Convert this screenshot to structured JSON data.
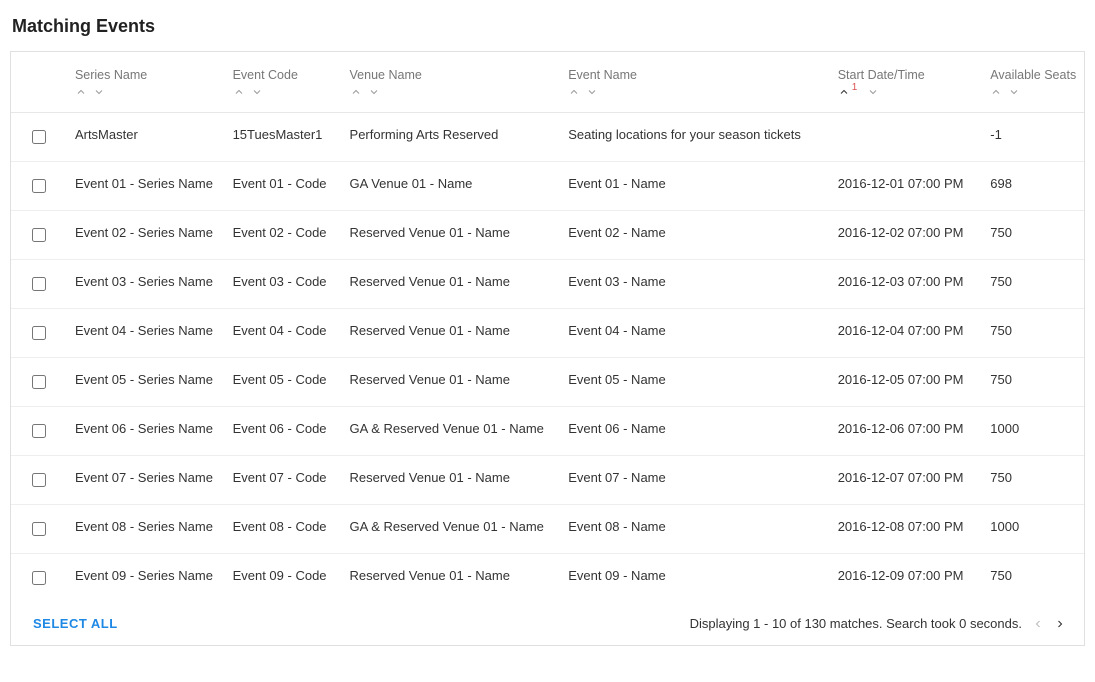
{
  "title": "Matching Events",
  "columns": {
    "series": "Series Name",
    "code": "Event Code",
    "venue": "Venue Name",
    "ename": "Event Name",
    "datetime": "Start Date/Time",
    "seats": "Available Seats"
  },
  "sort": {
    "active_column": "datetime",
    "direction": "asc",
    "rank": "1"
  },
  "rows": [
    {
      "series": "ArtsMaster",
      "code": "15TuesMaster1",
      "venue": "Performing Arts Reserved",
      "ename": "Seating locations for your season tickets",
      "datetime": "",
      "seats": "-1"
    },
    {
      "series": "Event 01 - Series Name",
      "code": "Event 01 - Code",
      "venue": "GA Venue 01 - Name",
      "ename": "Event 01 - Name",
      "datetime": "2016-12-01 07:00 PM",
      "seats": "698"
    },
    {
      "series": "Event 02 - Series Name",
      "code": "Event 02 - Code",
      "venue": "Reserved Venue 01 - Name",
      "ename": "Event 02 - Name",
      "datetime": "2016-12-02 07:00 PM",
      "seats": "750"
    },
    {
      "series": "Event 03 - Series Name",
      "code": "Event 03 - Code",
      "venue": "Reserved Venue 01 - Name",
      "ename": "Event 03 - Name",
      "datetime": "2016-12-03 07:00 PM",
      "seats": "750"
    },
    {
      "series": "Event 04 - Series Name",
      "code": "Event 04 - Code",
      "venue": "Reserved Venue 01 - Name",
      "ename": "Event 04 - Name",
      "datetime": "2016-12-04 07:00 PM",
      "seats": "750"
    },
    {
      "series": "Event 05 - Series Name",
      "code": "Event 05 - Code",
      "venue": "Reserved Venue 01 - Name",
      "ename": "Event 05 - Name",
      "datetime": "2016-12-05 07:00 PM",
      "seats": "750"
    },
    {
      "series": "Event 06 - Series Name",
      "code": "Event 06 - Code",
      "venue": "GA & Reserved Venue 01 - Name",
      "ename": "Event 06 - Name",
      "datetime": "2016-12-06 07:00 PM",
      "seats": "1000"
    },
    {
      "series": "Event 07 - Series Name",
      "code": "Event 07 - Code",
      "venue": "Reserved Venue 01 - Name",
      "ename": "Event 07 - Name",
      "datetime": "2016-12-07 07:00 PM",
      "seats": "750"
    },
    {
      "series": "Event 08 - Series Name",
      "code": "Event 08 - Code",
      "venue": "GA & Reserved Venue 01 - Name",
      "ename": "Event 08 - Name",
      "datetime": "2016-12-08 07:00 PM",
      "seats": "1000"
    },
    {
      "series": "Event 09 - Series Name",
      "code": "Event 09 - Code",
      "venue": "Reserved Venue 01 - Name",
      "ename": "Event 09 - Name",
      "datetime": "2016-12-09 07:00 PM",
      "seats": "750"
    }
  ],
  "footer": {
    "select_all": "SELECT ALL",
    "status": "Displaying 1 - 10 of 130 matches. Search took 0 seconds."
  }
}
